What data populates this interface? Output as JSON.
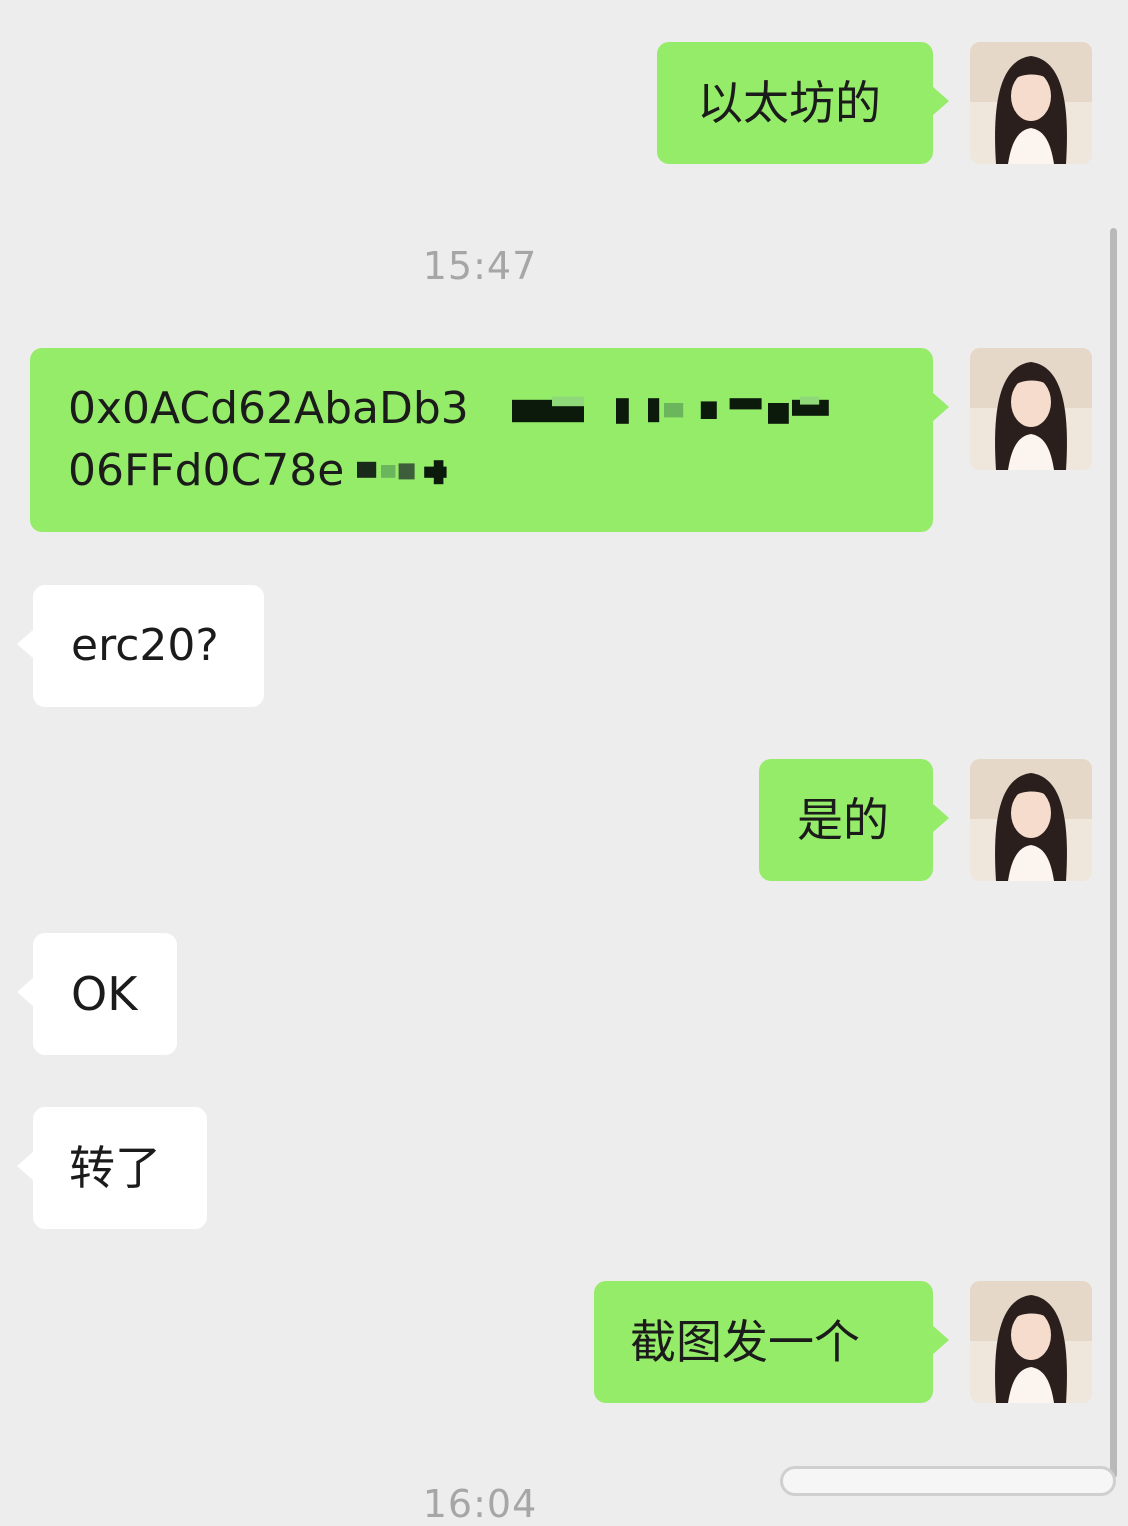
{
  "chat": {
    "timestamps": [
      "15:47",
      "16:04"
    ],
    "messages": [
      {
        "sender": "me",
        "text": "以太坊的"
      },
      {
        "sender": "me",
        "line1": "0x0ACd62AbaDb3",
        "line2": "06FFd0C78e"
      },
      {
        "sender": "other",
        "text": "erc20?"
      },
      {
        "sender": "me",
        "text": "是的"
      },
      {
        "sender": "other",
        "text": "OK"
      },
      {
        "sender": "other",
        "text": "转了"
      },
      {
        "sender": "me",
        "text": "截图发一个"
      }
    ]
  },
  "colors": {
    "background": "#ededed",
    "outgoing_bubble": "#95ec69",
    "incoming_bubble": "#ffffff",
    "timestamp_text": "#a6a6a6"
  },
  "icons": {
    "avatar": "user-avatar-photo",
    "redaction": "mosaic-censor"
  }
}
